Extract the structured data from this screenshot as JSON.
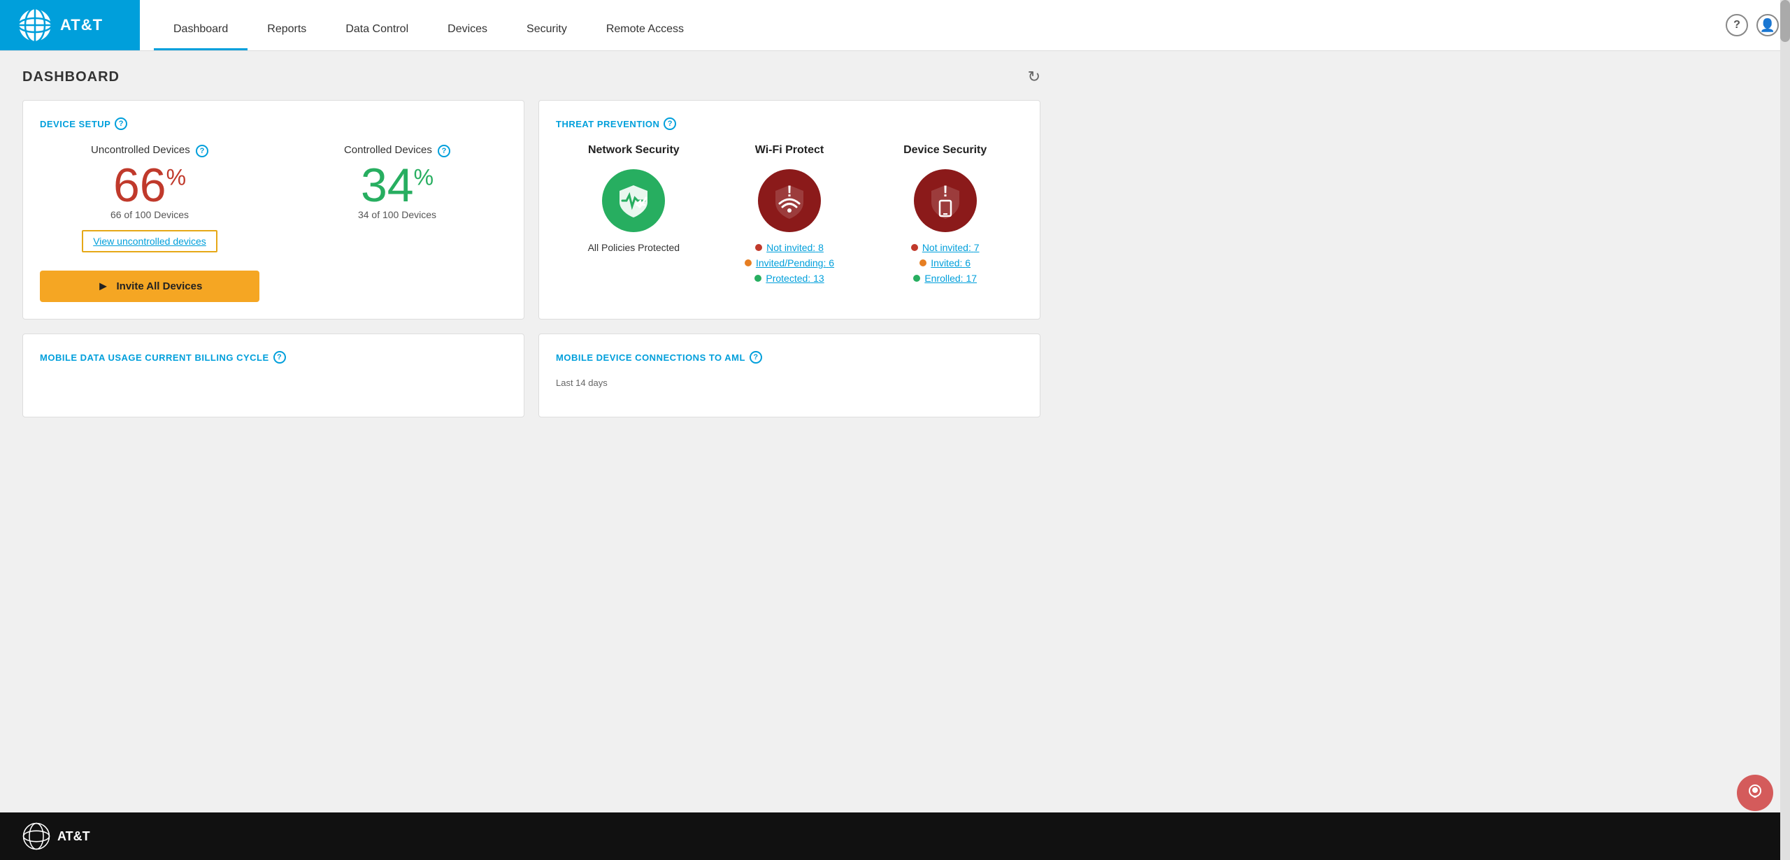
{
  "header": {
    "brand": "AT&T",
    "nav": [
      {
        "label": "Dashboard",
        "active": true
      },
      {
        "label": "Reports",
        "active": false
      },
      {
        "label": "Data Control",
        "active": false
      },
      {
        "label": "Devices",
        "active": false
      },
      {
        "label": "Security",
        "active": false
      },
      {
        "label": "Remote Access",
        "active": false
      }
    ],
    "help_icon": "?",
    "user_icon": "👤"
  },
  "page": {
    "title": "DASHBOARD",
    "refresh_icon": "↻"
  },
  "device_setup": {
    "section_title": "DEVICE SETUP",
    "help_symbol": "?",
    "uncontrolled": {
      "label": "Uncontrolled Devices",
      "percent": "66",
      "pct_sign": "%",
      "count": "66 of 100 Devices",
      "view_link": "View uncontrolled devices",
      "invite_btn": "Invite All Devices"
    },
    "controlled": {
      "label": "Controlled Devices",
      "percent": "34",
      "pct_sign": "%",
      "count": "34 of 100 Devices"
    }
  },
  "threat_prevention": {
    "section_title": "THREAT PREVENTION",
    "help_symbol": "?",
    "network_security": {
      "title": "Network Security",
      "status": "All Policies Protected"
    },
    "wifi_protect": {
      "title": "Wi-Fi Protect",
      "not_invited_label": "Not invited:",
      "not_invited_count": "8",
      "invited_pending_label": "Invited/Pending:",
      "invited_pending_count": "6",
      "protected_label": "Protected:",
      "protected_count": "13"
    },
    "device_security": {
      "title": "Device Security",
      "not_invited_label": "Not invited:",
      "not_invited_count": "7",
      "invited_label": "Invited:",
      "invited_count": "6",
      "enrolled_label": "Enrolled:",
      "enrolled_count": "17"
    }
  },
  "mobile_data": {
    "section_title": "MOBILE DATA USAGE CURRENT BILLING CYCLE",
    "help_symbol": "?"
  },
  "mobile_connections": {
    "section_title": "MOBILE DEVICE CONNECTIONS TO AML",
    "help_symbol": "?",
    "subtitle": "Last 14 days"
  },
  "footer": {
    "brand": "AT&T"
  }
}
